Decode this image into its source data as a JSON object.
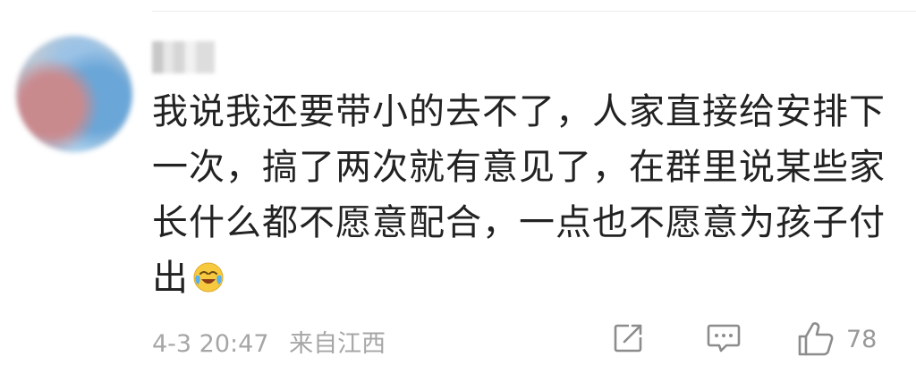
{
  "comment": {
    "username": "来…",
    "text": "我说我还要带小的去不了，人家直接给安排下一次，搞了两次就有意见了，在群里说某些家长什么都不愿意配合，一点也不愿意为孩子付出",
    "emoji": "laughing-crying-emoji",
    "date": "4-3 20:47",
    "location": "来自江西",
    "like_count": "78"
  },
  "icons": {
    "share": "share-icon",
    "reply": "comment-icon",
    "like": "thumbs-up-icon"
  },
  "colors": {
    "text": "#222222",
    "meta": "#a6a6a6",
    "icon": "#8c8c8c"
  }
}
